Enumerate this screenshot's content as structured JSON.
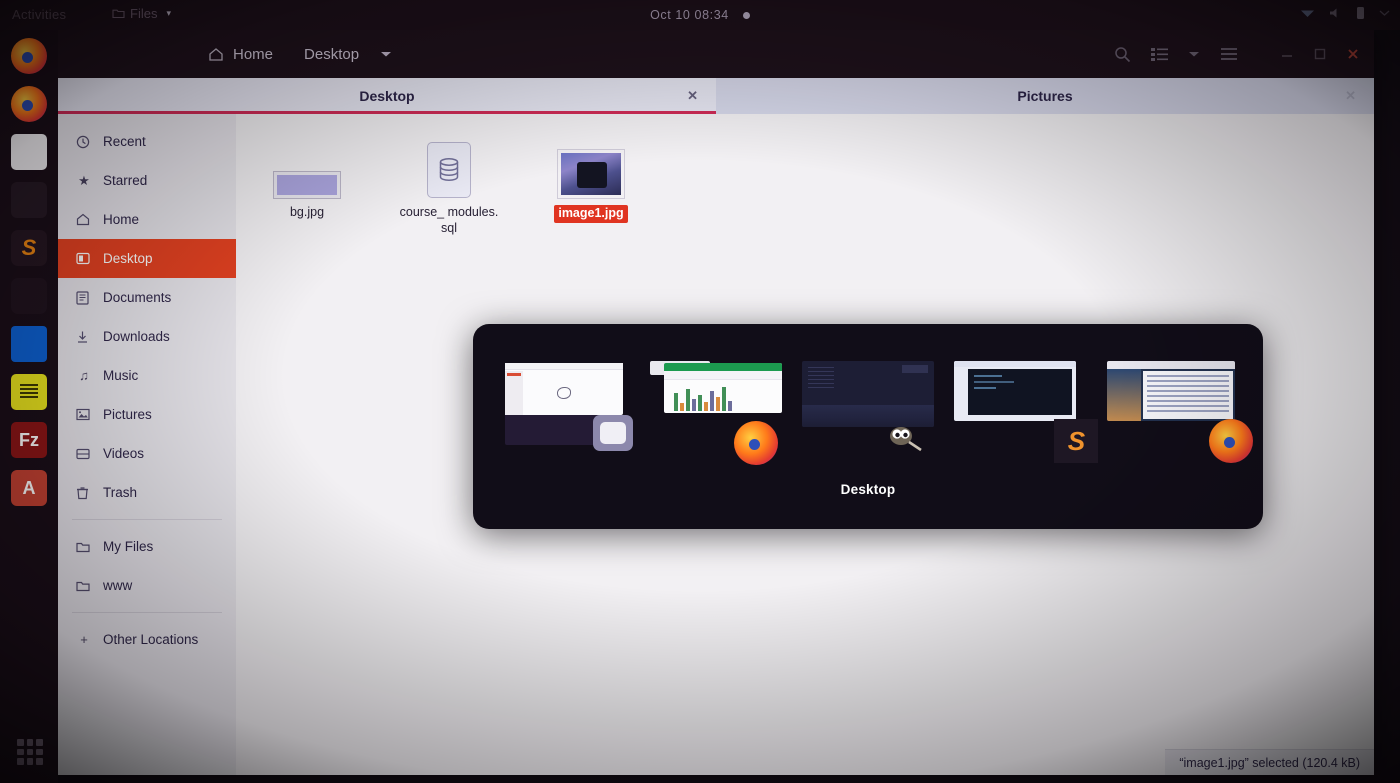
{
  "topbar": {
    "activities": "Activities",
    "app_menu": "Files",
    "app_menu_icon": "files-icon",
    "app_menu_chevron": "chevron-down-icon",
    "clock": "Oct 10  08:34",
    "notification_dot": "notification-dot",
    "status_icons": [
      "network-icon",
      "volume-icon",
      "battery-icon",
      "chevron-down-icon"
    ]
  },
  "dock": {
    "items": [
      {
        "name": "firefox",
        "label": "Firefox"
      },
      {
        "name": "firefox-dev",
        "label": "Firefox Developer Edition"
      },
      {
        "name": "files",
        "label": "Files"
      },
      {
        "name": "terminal",
        "label": "Terminal"
      },
      {
        "name": "sublime-text",
        "label": "S"
      },
      {
        "name": "screenshot",
        "label": ""
      },
      {
        "name": "vscode",
        "label": ""
      },
      {
        "name": "text-editor",
        "label": ""
      },
      {
        "name": "filezilla",
        "label": "Fz"
      },
      {
        "name": "anaconda",
        "label": "A"
      }
    ],
    "show_apps_label": "Show Applications"
  },
  "window": {
    "breadcrumb": {
      "home_icon": "home-icon",
      "home": "Home",
      "current": "Desktop",
      "chevron": "chevron-down-icon"
    },
    "header_buttons": [
      {
        "name": "search-icon",
        "glyph": "⌕"
      },
      {
        "name": "list-view-icon",
        "glyph": "☰"
      },
      {
        "name": "view-options-chevron-icon",
        "glyph": "▾"
      },
      {
        "name": "hamburger-menu-icon",
        "glyph": "☰"
      }
    ],
    "window_controls": [
      {
        "name": "minimize-button",
        "glyph": "–"
      },
      {
        "name": "maximize-button",
        "glyph": "□"
      },
      {
        "name": "close-button",
        "glyph": "✕"
      }
    ],
    "tabs": [
      {
        "label": "Desktop",
        "active": true,
        "close_glyph": "✕"
      },
      {
        "label": "Pictures",
        "active": false,
        "close_glyph": "✕"
      }
    ],
    "accent_color": "#cf2a55",
    "selection_color": "#e2401f"
  },
  "sidebar": {
    "items": [
      {
        "label": "Recent",
        "icon": "clock-icon",
        "glyph": "◴",
        "selected": false
      },
      {
        "label": "Starred",
        "icon": "star-icon",
        "glyph": "★",
        "selected": false
      },
      {
        "label": "Home",
        "icon": "home-icon",
        "glyph": "⌂",
        "selected": false
      },
      {
        "label": "Desktop",
        "icon": "desktop-icon",
        "glyph": "▣",
        "selected": true
      },
      {
        "label": "Documents",
        "icon": "document-icon",
        "glyph": "὜e",
        "selected": false
      },
      {
        "label": "Downloads",
        "icon": "download-icon",
        "glyph": "⇩",
        "selected": false
      },
      {
        "label": "Music",
        "icon": "music-note-icon",
        "glyph": "♫",
        "selected": false
      },
      {
        "label": "Pictures",
        "icon": "picture-icon",
        "glyph": "⛰",
        "selected": false
      },
      {
        "label": "Videos",
        "icon": "video-icon",
        "glyph": "⬚",
        "selected": false
      },
      {
        "label": "Trash",
        "icon": "trash-icon",
        "glyph": "Ὕ1",
        "selected": false
      }
    ],
    "bookmarks": [
      {
        "label": "My Files",
        "icon": "folder-icon",
        "glyph": "὜0"
      },
      {
        "label": "www",
        "icon": "folder-icon",
        "glyph": "὜0"
      }
    ],
    "other_locations": {
      "label": "Other Locations",
      "icon": "plus-icon",
      "glyph": "+"
    }
  },
  "files": [
    {
      "name": "bg.jpg",
      "thumb": "image-thumbnail",
      "selected": false
    },
    {
      "name": "course_ modules. sql",
      "thumb": "database-file-icon",
      "selected": false
    },
    {
      "name": "image1.jpg",
      "thumb": "image-thumbnail",
      "selected": true
    }
  ],
  "switcher": {
    "label": "Desktop",
    "windows": [
      {
        "name": "files-window-preview",
        "app": "files",
        "badge": "folder-icon"
      },
      {
        "name": "libreoffice-calc-preview",
        "app": "firefox",
        "badge": "firefox-icon"
      },
      {
        "name": "gimp-preview",
        "app": "gimp",
        "badge": "gimp-icon"
      },
      {
        "name": "sublime-text-preview",
        "app": "sublime-text",
        "badge": "sublime-icon"
      },
      {
        "name": "firefox-window-preview",
        "app": "firefox",
        "badge": "firefox-icon"
      }
    ]
  },
  "status": {
    "text": "“image1.jpg” selected  (120.4 kB)"
  }
}
